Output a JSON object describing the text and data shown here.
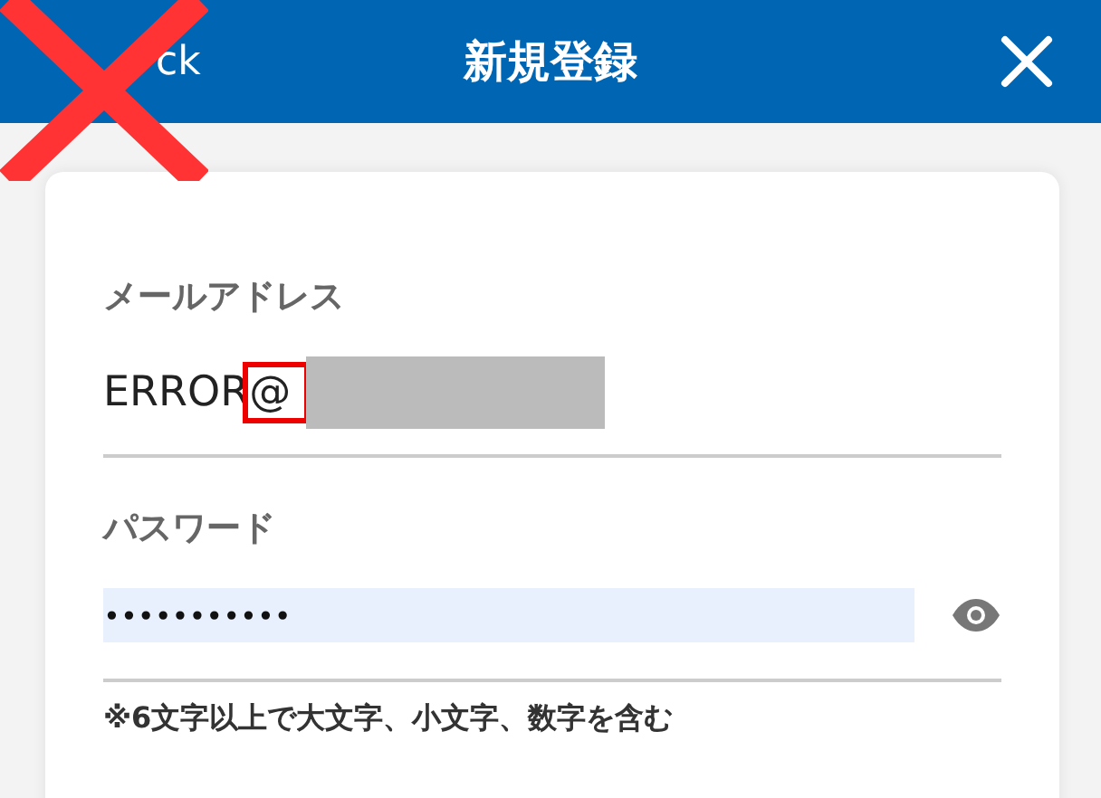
{
  "header": {
    "back": {
      "label": "ck",
      "crossed_out": true
    },
    "title": "新規登録",
    "close": true
  },
  "form": {
    "email": {
      "label": "メールアドレス",
      "value": "ERROR",
      "highlighted": "@",
      "redacted": true
    },
    "password": {
      "label": "パスワード",
      "value": "•••••••••••",
      "autofilled": true,
      "hint": "※6文字以上で大文字、小文字、数字を含む"
    }
  }
}
